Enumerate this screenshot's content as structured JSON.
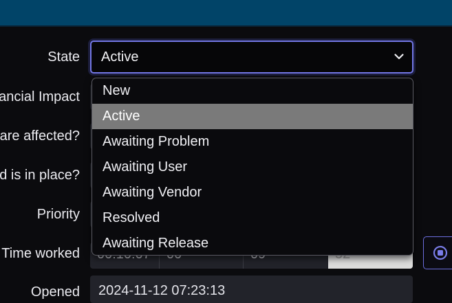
{
  "form": {
    "labels": {
      "state": "State",
      "financial_impact": "ancial Impact",
      "affected": "are affected?",
      "workaround": "nd is in place?",
      "priority": "Priority",
      "time_worked": "Time worked",
      "opened": "Opened"
    },
    "state": {
      "selected": "Active",
      "options": [
        "New",
        "Active",
        "Awaiting Problem",
        "Awaiting User",
        "Awaiting Vendor",
        "Resolved",
        "Awaiting Release"
      ]
    },
    "time_worked": {
      "total": "00:10:07",
      "hours": "00",
      "minutes": "09",
      "seconds": "52"
    },
    "opened": {
      "value": "2024-11-12 07:23:13"
    }
  },
  "icons": {
    "dropdown": "chevron-down-icon",
    "timer": "stop-circle-icon"
  },
  "colors": {
    "header": "#014468",
    "focus_border": "#7377e6",
    "selected_option": "#7a7a7a"
  }
}
